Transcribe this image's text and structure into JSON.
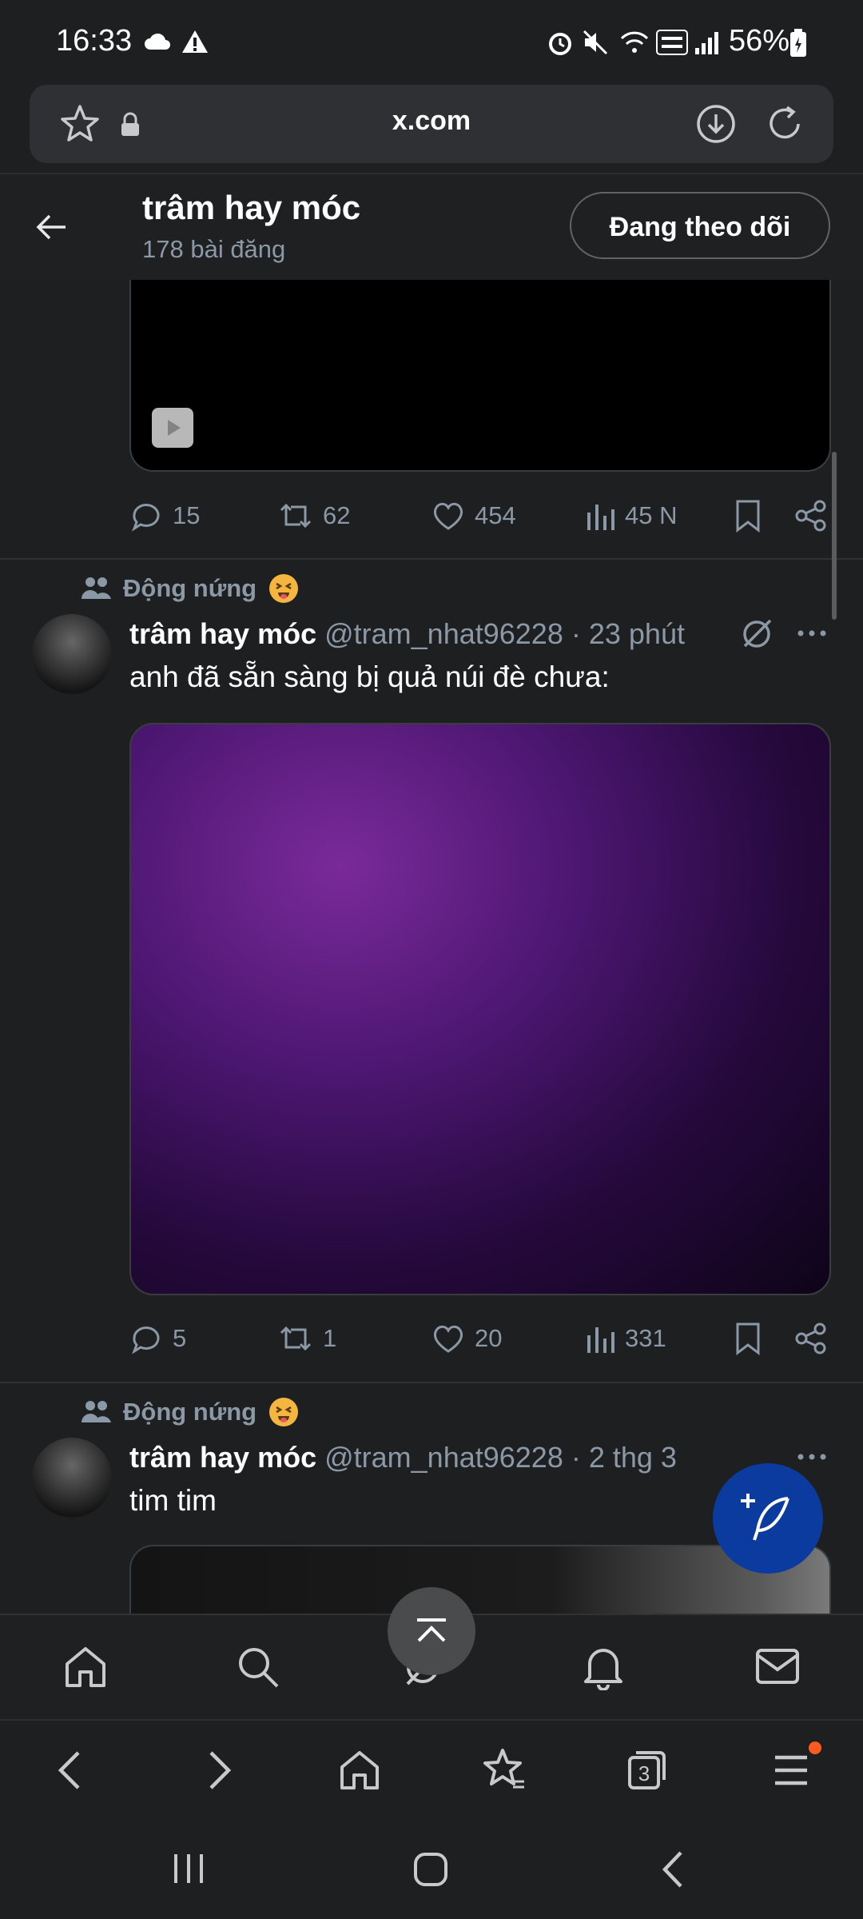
{
  "status_bar": {
    "time": "16:33",
    "battery": "56%"
  },
  "browser": {
    "url": "x.com"
  },
  "profile": {
    "name": "trâm hay móc",
    "post_count": "178 bài đăng",
    "follow_label": "Đang theo dõi"
  },
  "post1": {
    "stats": {
      "replies": "15",
      "reposts": "62",
      "likes": "454",
      "views": "45 N"
    }
  },
  "post2": {
    "context": "Động nứng",
    "name": "trâm hay móc",
    "handle": "@tram_nhat96228",
    "time": "· 23 phút",
    "text": "anh đã sẵn sàng bị quả núi đè chưa:",
    "stats": {
      "replies": "5",
      "reposts": "1",
      "likes": "20",
      "views": "331"
    }
  },
  "post3": {
    "context": "Động nứng",
    "name": "trâm hay móc",
    "handle": "@tram_nhat96228",
    "time": "· 2 thg 3",
    "text": "tim tim"
  },
  "browser_nav": {
    "tabs_count": "3"
  },
  "colors": {
    "background": "#1e1f21",
    "muted": "#8b98a5",
    "fab": "#0b3b9e",
    "emoji": "#f4b63f"
  }
}
